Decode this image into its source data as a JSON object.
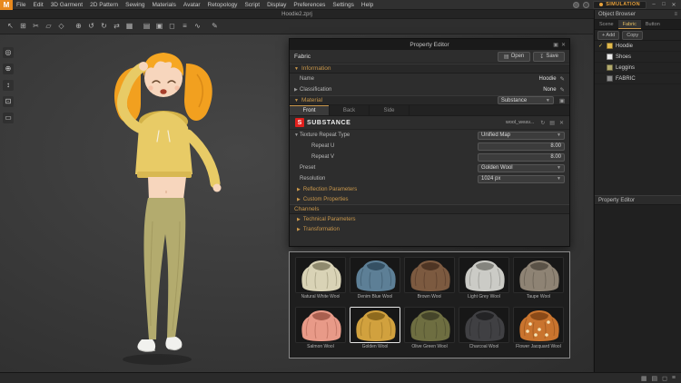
{
  "colors": {
    "accent_amber": "#c9974b",
    "substance_red": "#e1201d",
    "simulation_orange": "#e8a23c",
    "logo_orange": "#e8891d"
  },
  "window": {
    "logo_letter": "M",
    "title": "Hoodie2.zprj",
    "controls": [
      {
        "name": "minimize-button",
        "glyph": "–"
      },
      {
        "name": "maximize-button",
        "glyph": "□"
      },
      {
        "name": "close-button",
        "glyph": "✕"
      }
    ]
  },
  "menu": {
    "items": [
      "File",
      "Edit",
      "3D Garment",
      "2D Pattern",
      "Sewing",
      "Materials",
      "Avatar",
      "Retopology",
      "Script",
      "Display",
      "Preferences",
      "Settings",
      "Help"
    ]
  },
  "simulation": {
    "label": "SIMULATION"
  },
  "toolbar": {
    "icons": [
      {
        "name": "cursor-tool-icon",
        "glyph": "↖"
      },
      {
        "name": "add-pattern-tool-icon",
        "glyph": "⊞"
      },
      {
        "name": "scissors-tool-icon",
        "glyph": "✂"
      },
      {
        "name": "transform-tool-icon",
        "glyph": "▱"
      },
      {
        "name": "polygon-tool-icon",
        "glyph": "◇"
      },
      {
        "name": "add-point-tool-icon",
        "glyph": "⊕"
      },
      {
        "name": "undo-icon",
        "glyph": "↺"
      },
      {
        "name": "redo-icon",
        "glyph": "↻"
      },
      {
        "name": "swap-tool-icon",
        "glyph": "⇄"
      },
      {
        "name": "grid-tool-icon",
        "glyph": "▦"
      },
      {
        "name": "layers-tool-icon",
        "glyph": "▤"
      },
      {
        "name": "select-mesh-tool-icon",
        "glyph": "▣"
      },
      {
        "name": "box-select-tool-icon",
        "glyph": "◻"
      },
      {
        "name": "list-tool-icon",
        "glyph": "≡"
      },
      {
        "name": "curve-tool-icon",
        "glyph": "∿"
      },
      {
        "name": "pen-tool-icon",
        "glyph": "✎"
      }
    ]
  },
  "left_toolbar": {
    "icons": [
      {
        "name": "view-orbit-tool-icon",
        "glyph": "◎"
      },
      {
        "name": "view-zoom-tool-icon",
        "glyph": "⊕"
      },
      {
        "name": "view-pan-tool-icon",
        "glyph": "↕"
      },
      {
        "name": "view-frame-tool-icon",
        "glyph": "⊡"
      },
      {
        "name": "view-reset-tool-icon",
        "glyph": "▭"
      }
    ]
  },
  "property_editor": {
    "title": "Property Editor",
    "fabric_label": "Fabric",
    "open_button": "Open",
    "save_button": "Save",
    "information": {
      "title": "Information",
      "rows": [
        {
          "label": "Name",
          "value": "Hoodie",
          "expandable": false
        },
        {
          "label": "Classification",
          "value": "None",
          "expandable": true
        }
      ]
    },
    "material": {
      "title": "Material",
      "type_value": "Substance",
      "tabs": [
        "Front",
        "Back",
        "Side"
      ],
      "active_tab": "Front",
      "brand": "SUBSTANCE",
      "file_name": "wool_weav...",
      "params": [
        {
          "label": "Texture Repeat Type",
          "value": "Unified Map",
          "control": "dropdown",
          "expander": true,
          "indent": 0
        },
        {
          "label": "Repeat U",
          "value": "8.00",
          "control": "field",
          "expander": false,
          "indent": 1
        },
        {
          "label": "Repeat V",
          "value": "8.00",
          "control": "field",
          "expander": false,
          "indent": 1
        },
        {
          "label": "Preset",
          "value": "Golden Wool",
          "control": "dropdown",
          "expander": false,
          "indent": 0
        },
        {
          "label": "Resolution",
          "value": "1024 px",
          "control": "dropdown",
          "expander": false,
          "indent": 0
        }
      ],
      "collapsed": [
        "Reflection Parameters",
        "Custom Properties"
      ]
    },
    "channels": {
      "title": "Channels",
      "collapsed": [
        "Technical Parameters",
        "Transformation"
      ]
    }
  },
  "materials_panel": {
    "items": [
      {
        "label": "Natural White Wool",
        "color": "#d9d3b6",
        "dark": "#8f8a6e",
        "selected": false,
        "pattern": "plain"
      },
      {
        "label": "Denim Blue Wool",
        "color": "#5d7f96",
        "dark": "#355063",
        "selected": false,
        "pattern": "plain"
      },
      {
        "label": "Brown Wool",
        "color": "#7c5a40",
        "dark": "#4e3524",
        "selected": false,
        "pattern": "plain"
      },
      {
        "label": "Light Grey Wool",
        "color": "#cbcbc6",
        "dark": "#84847e",
        "selected": false,
        "pattern": "plain"
      },
      {
        "label": "Taupe Wool",
        "color": "#8e8374",
        "dark": "#5a5247",
        "selected": false,
        "pattern": "plain"
      },
      {
        "label": "Salmon Wool",
        "color": "#e89a88",
        "dark": "#a95f4f",
        "selected": false,
        "pattern": "plain"
      },
      {
        "label": "Golden Wool",
        "color": "#d1a13e",
        "dark": "#8e6a1e",
        "selected": true,
        "pattern": "plain"
      },
      {
        "label": "Olive Green Wool",
        "color": "#6e6e41",
        "dark": "#45452a",
        "selected": false,
        "pattern": "plain"
      },
      {
        "label": "Charcoal Wool",
        "color": "#404043",
        "dark": "#232325",
        "selected": false,
        "pattern": "plain"
      },
      {
        "label": "Flower Jacquard Wool",
        "color": "#c9742e",
        "dark": "#8a4a18",
        "selected": false,
        "pattern": "floral"
      }
    ]
  },
  "object_browser": {
    "title": "Object Browser",
    "tabs": [
      "Scene",
      "Fabric",
      "Button"
    ],
    "active_tab": "Fabric",
    "actions": [
      "+ Add",
      "Copy"
    ],
    "rows": [
      {
        "name": "Hoodie",
        "color": "#e3bb4e",
        "checked": true
      },
      {
        "name": "Shoes",
        "color": "#ececec",
        "checked": false
      },
      {
        "name": "Leggins",
        "color": "#b3ab6e",
        "checked": false
      },
      {
        "name": "FABRIC",
        "color": "#8d8d8d",
        "checked": false
      }
    ]
  },
  "right_property_editor": {
    "title": "Property Editor"
  },
  "status_bar": {
    "icons": [
      {
        "name": "grid-view-icon",
        "glyph": "▦"
      },
      {
        "name": "rows-view-icon",
        "glyph": "▤"
      },
      {
        "name": "window-view-icon",
        "glyph": "◻"
      },
      {
        "name": "menu-icon",
        "glyph": "≡"
      }
    ]
  }
}
